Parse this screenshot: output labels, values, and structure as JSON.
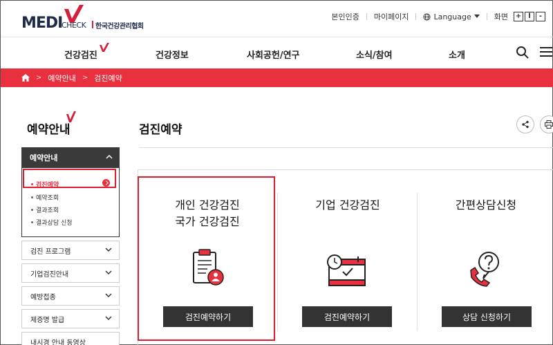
{
  "header": {
    "logo": {
      "medi": "MEDI",
      "check": "CHECK",
      "org_name": "한국건강관리협회"
    },
    "util": {
      "verify": "본인인증",
      "mypage": "마이페이지",
      "language": "Language",
      "screen": "화면",
      "zoom_in": "+",
      "zoom_reset": "l",
      "zoom_out": "-"
    }
  },
  "gnb": {
    "items": [
      {
        "label": "건강검진"
      },
      {
        "label": "건강정보"
      },
      {
        "label": "사회공헌/연구"
      },
      {
        "label": "소식/참여"
      },
      {
        "label": "소개"
      }
    ]
  },
  "breadcrumb": {
    "items": [
      "예약안내",
      "검진예약"
    ]
  },
  "sidebar": {
    "title": "예약안내",
    "open_menu": {
      "label": "예약안내",
      "items": [
        {
          "label": "검진예약",
          "active": true
        },
        {
          "label": "예약조회"
        },
        {
          "label": "결과조회"
        },
        {
          "label": "결과상담 신청"
        }
      ]
    },
    "menus": [
      {
        "label": "검진 프로그램"
      },
      {
        "label": "기업검진안내"
      },
      {
        "label": "예방접종"
      },
      {
        "label": "제증명 발급"
      },
      {
        "label": "내시경 안내 동영상"
      }
    ]
  },
  "main": {
    "title": "검진예약",
    "cards": [
      {
        "title_line1": "개인 건강검진",
        "title_line2": "국가 건강검진",
        "button": "검진예약하기",
        "icon": "clipboard-user-icon"
      },
      {
        "title_line1": "기업 건강검진",
        "button": "검진예약하기",
        "icon": "calendar-check-icon"
      },
      {
        "title_line1": "간편상담신청",
        "button": "상담 신청하기",
        "icon": "phone-question-icon"
      }
    ]
  },
  "colors": {
    "brand_red": "#e9303f",
    "navy": "#1e2a4a",
    "dark": "#333333"
  }
}
